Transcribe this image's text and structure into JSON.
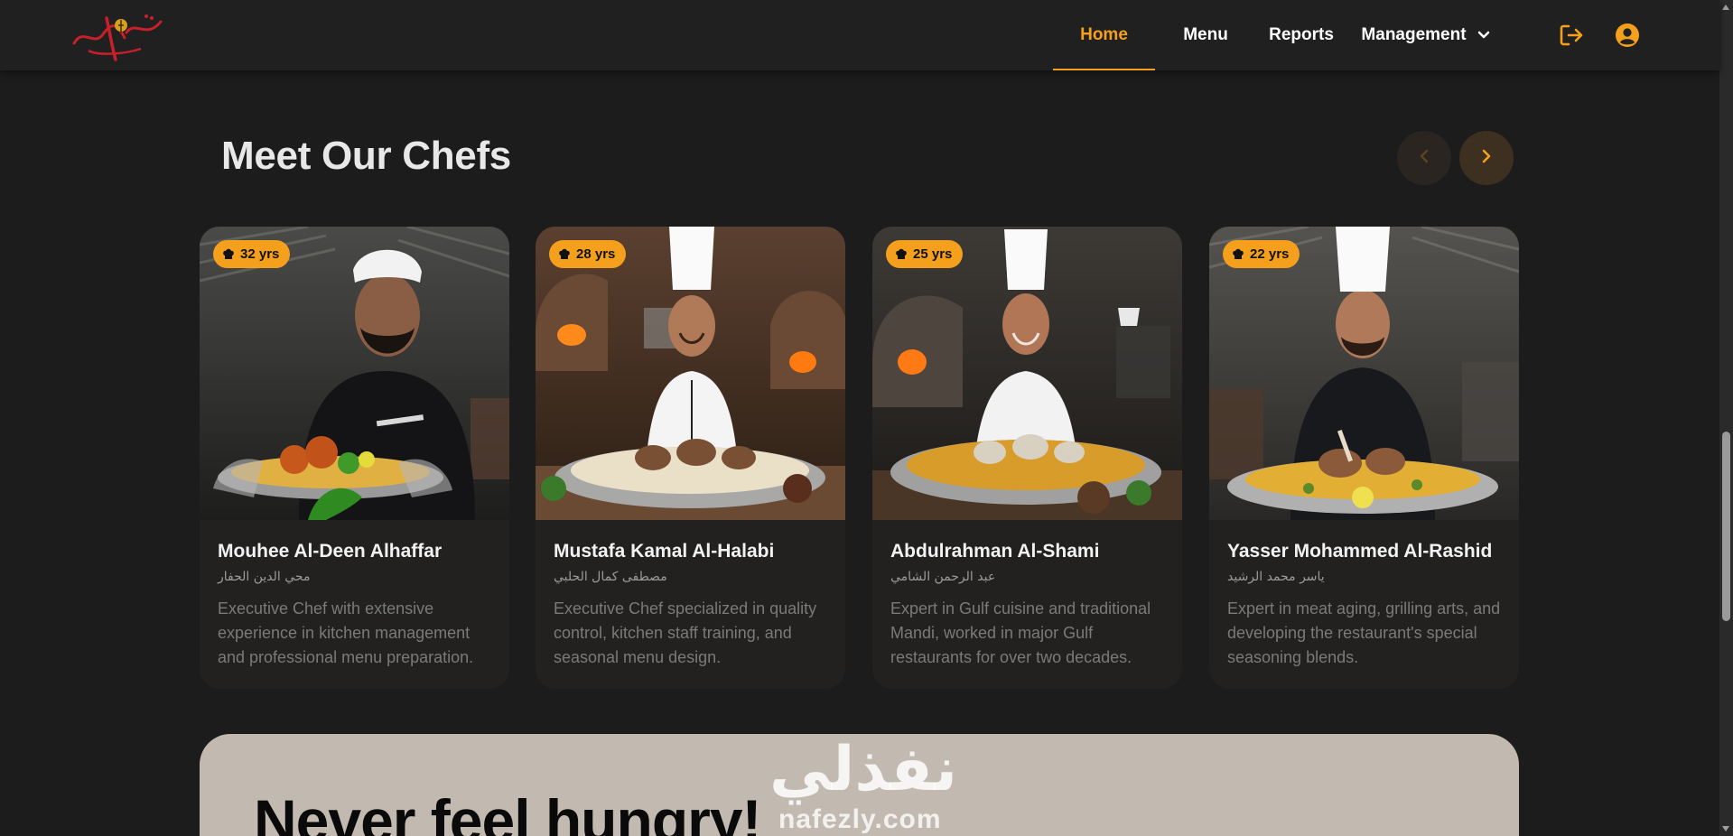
{
  "navbar": {
    "logo_icon": "restaurant-logo",
    "links": [
      {
        "label": "Home",
        "active": true
      },
      {
        "label": "Menu"
      },
      {
        "label": "Reports"
      },
      {
        "label": "Management"
      }
    ],
    "accent_color": "#f5a01c",
    "icons": [
      "logout-icon",
      "account-circle-icon",
      "chevron-down-icon"
    ]
  },
  "section": {
    "title": "Meet Our Chefs",
    "carousel_icons": [
      "chevron-left-icon",
      "chevron-right-icon"
    ]
  },
  "chefs": [
    {
      "experience": "32 yrs",
      "name": "Mouhee Al-Deen Alhaffar",
      "name_ar": "محي الدين الحفار",
      "description": "Executive Chef with extensive experience in kitchen management and professional menu preparation."
    },
    {
      "experience": "28 yrs",
      "name": "Mustafa Kamal Al-Halabi",
      "name_ar": "مصطفى كمال الحلبي",
      "description": "Executive Chef specialized in quality control, kitchen staff training, and seasonal menu design."
    },
    {
      "experience": "25 yrs",
      "name": "Abdulrahman Al-Shami",
      "name_ar": "عبد الرحمن الشامي",
      "description": "Expert in Gulf cuisine and traditional Mandi, worked in major Gulf restaurants for over two decades."
    },
    {
      "experience": "22 yrs",
      "name": "Yasser Mohammed Al-Rashid",
      "name_ar": "ياسر محمد الرشيد",
      "description": "Expert in meat aging, grilling arts, and developing the restaurant's special seasoning blends."
    }
  ],
  "banner": {
    "title": "Never feel hungry!",
    "watermark_ar": "نفذلي",
    "watermark_url": "nafezly.com"
  }
}
